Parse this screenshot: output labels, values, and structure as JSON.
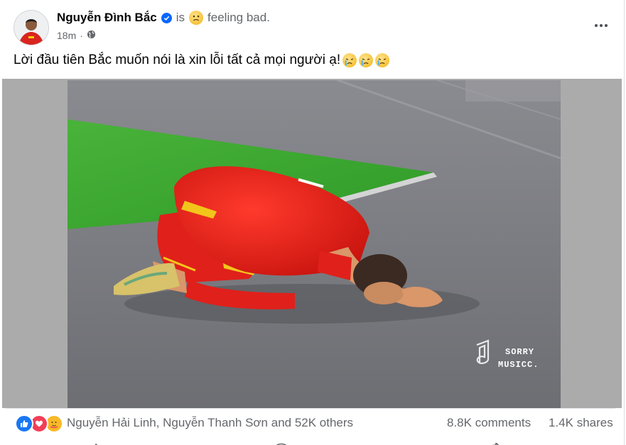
{
  "post": {
    "author": "Nguyễn Đình Bắc",
    "is_text": "is",
    "feeling_text": "feeling bad.",
    "time": "18m",
    "privacy_icon": "globe-icon",
    "text": "Lời đầu tiên Bắc muốn nói là xin lỗi tất cả mọi người ạ!",
    "text_emojis": [
      "crying-face",
      "crying-face",
      "crying-face"
    ]
  },
  "photo": {
    "watermark_line1": "SORRY",
    "watermark_line2": "MUSICC."
  },
  "footer": {
    "reaction_icons": [
      "like-icon",
      "love-icon",
      "care-icon"
    ],
    "reaction_names": "Nguyễn Hải Linh, Nguyễn Thanh Sơn and 52K others",
    "comments": "8.8K comments",
    "shares": "1.4K shares"
  },
  "colors": {
    "accent": "#0866ff",
    "muted": "#65676b",
    "like": "#1877f2",
    "love": "#f33e58"
  }
}
